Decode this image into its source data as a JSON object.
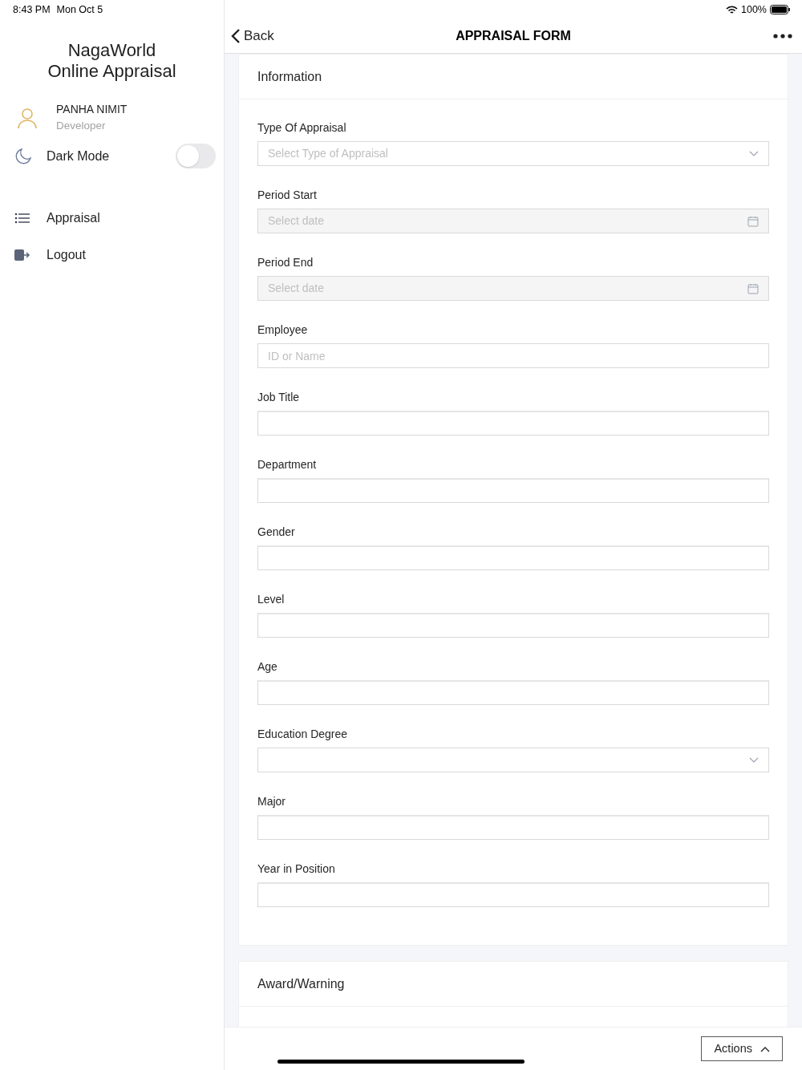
{
  "status_bar": {
    "time": "8:43 PM",
    "date": "Mon Oct 5",
    "battery": "100%"
  },
  "sidebar": {
    "title_lines": [
      "NagaWorld",
      "Online Appraisal"
    ],
    "user": {
      "name": "PANHA NIMIT",
      "role": "Developer"
    },
    "dark_mode": {
      "label": "Dark Mode",
      "on": false
    },
    "items": [
      {
        "label": "Appraisal",
        "kind": "list"
      },
      {
        "label": "Logout",
        "kind": "logout"
      }
    ]
  },
  "header": {
    "back": "Back",
    "title": "APPRAISAL FORM"
  },
  "sections": [
    {
      "title": "Information",
      "fields": [
        {
          "label": "Type Of Appraisal",
          "kind": "select",
          "placeholder": "Select Type of Appraisal"
        },
        {
          "label": "Period Start",
          "kind": "date",
          "placeholder": "Select date"
        },
        {
          "label": "Period End",
          "kind": "date",
          "placeholder": "Select date"
        },
        {
          "label": "Employee",
          "kind": "text",
          "placeholder": "ID or Name"
        },
        {
          "label": "Job Title",
          "kind": "readonly"
        },
        {
          "label": "Department",
          "kind": "readonly"
        },
        {
          "label": "Gender",
          "kind": "readonly"
        },
        {
          "label": "Level",
          "kind": "readonly"
        },
        {
          "label": "Age",
          "kind": "readonly"
        },
        {
          "label": "Education Degree",
          "kind": "select"
        },
        {
          "label": "Major",
          "kind": "readonly"
        },
        {
          "label": "Year in Position",
          "kind": "readonly"
        }
      ]
    },
    {
      "title": "Award/Warning"
    }
  ],
  "actions": {
    "label": "Actions"
  }
}
